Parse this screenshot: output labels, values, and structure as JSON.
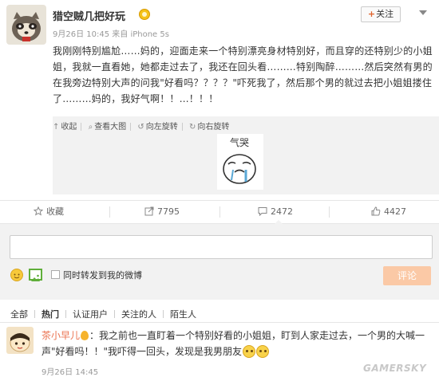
{
  "post": {
    "username": "猎空贼几把好玩",
    "meta": "9月26日 10:45 来自 iPhone 5s",
    "follow_label": "关注",
    "text": "我刚刚特别尴尬……妈的，迎面走来一个特别漂亮身材特别好，而且穿的还特别少的小姐姐，我就一直看她，她都走过去了，我还在回头看………特别陶醉………然后突然有男的在我旁边特别大声的问我\"好看吗？？？？\"吓死我了，然后那个男的就过去把小姐姐搂住了………妈的，我好气啊！！…！！！"
  },
  "media": {
    "tools": [
      "收起",
      "查看大图",
      "向左旋转",
      "向右旋转"
    ],
    "sticker_text": "气哭"
  },
  "actions": {
    "favorite_label": "收藏",
    "repost_count": "7795",
    "comment_count": "2472",
    "like_count": "4427"
  },
  "composer": {
    "input_value": "",
    "repost_checkbox_label": "同时转发到我的微博",
    "submit_label": "评论",
    "submit_color": "#fbc9a6"
  },
  "filters": {
    "tabs": [
      "全部",
      "热门",
      "认证用户",
      "关注的人",
      "陌生人"
    ],
    "active": "热门"
  },
  "comment": {
    "username": "茶小早儿",
    "text": "：我之前也一直盯着一个特别好看的小姐姐，盯到人家走过去，一个男的大喊一声\"好看吗！！\"我吓得一回头，发现是我男朋友",
    "time": "9月26日 14:45"
  },
  "colors": {
    "accent": "#eb7350",
    "panel_bg": "#f2f2f2"
  },
  "icons": {
    "collapse": "arrow-up-icon",
    "zoom": "magnifier-icon",
    "rotate_left": "rotate-left-icon",
    "rotate_right": "rotate-right-icon",
    "favorite": "star-icon",
    "repost": "share-icon",
    "comment": "comment-bubble-icon",
    "like": "thumbs-up-icon"
  },
  "watermark": "GAMERSKY"
}
